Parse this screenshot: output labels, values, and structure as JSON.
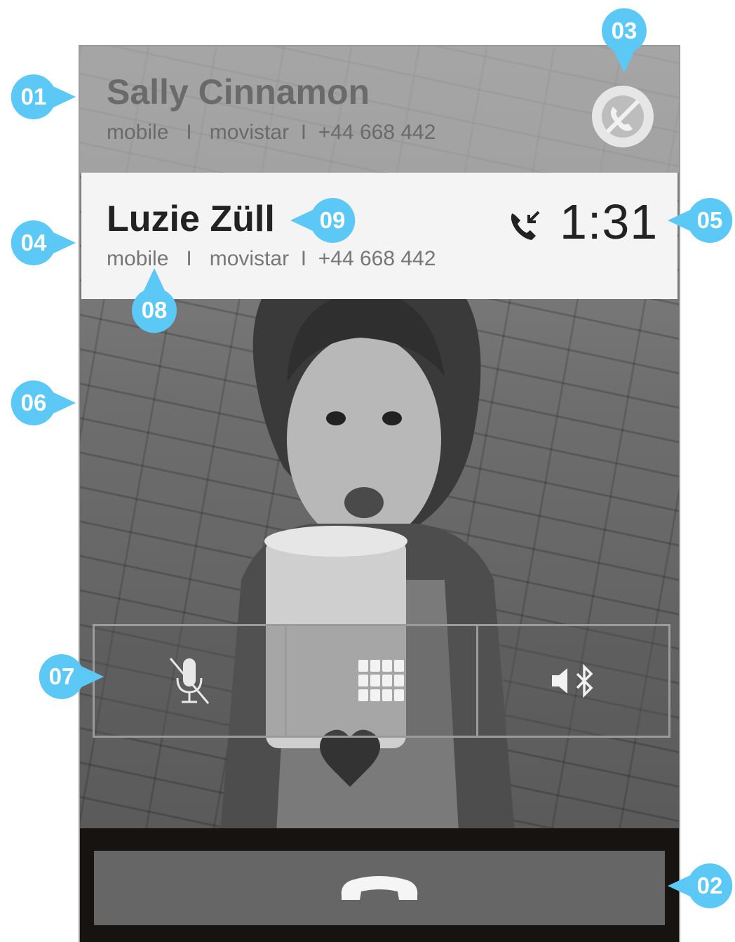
{
  "held_call": {
    "name": "Sally Cinnamon",
    "info": "mobile   I   movistar  I  +44 668 442",
    "icon": "call-on-hold-icon"
  },
  "active_call": {
    "name": "Luzie Züll",
    "info": "mobile   I   movistar  I  +44 668 442",
    "timer": "1:31",
    "icon": "incoming-call-icon"
  },
  "controls": [
    {
      "icon": "mic-muted-icon"
    },
    {
      "icon": "keypad-icon"
    },
    {
      "icon": "speaker-bluetooth-icon"
    }
  ],
  "end_call": {
    "icon": "end-call-icon"
  },
  "annotations": [
    "01",
    "02",
    "03",
    "04",
    "05",
    "06",
    "07",
    "08",
    "09"
  ],
  "colors": {
    "annotation": "#5bc8f5",
    "active_bar": "#f4f4f4",
    "held_bar": "#afafaf",
    "end_button": "#666666"
  }
}
